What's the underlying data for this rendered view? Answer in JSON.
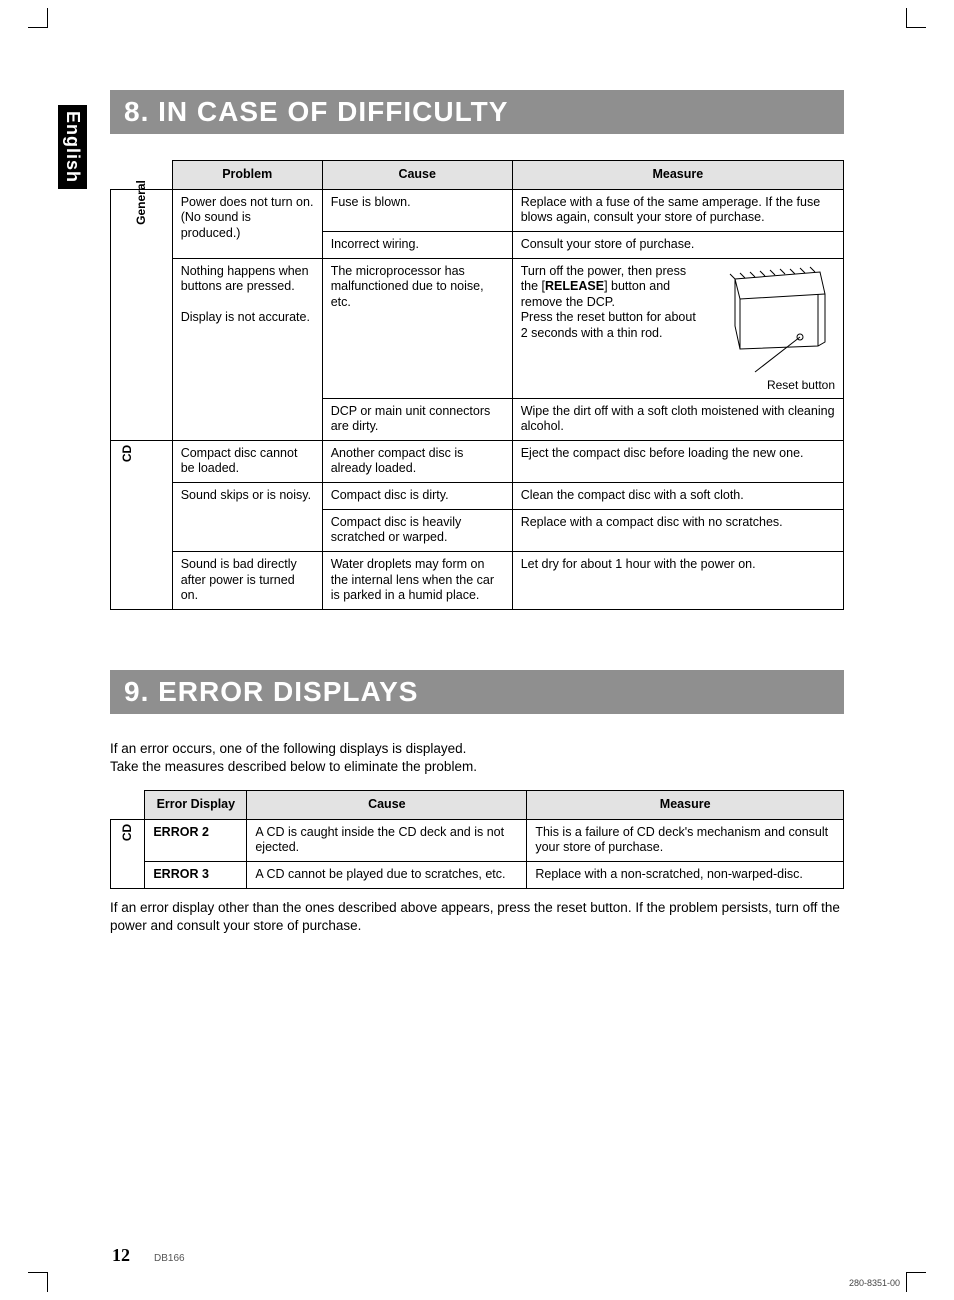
{
  "language_tab": "English",
  "section1": {
    "title": "8. IN CASE OF DIFFICULTY",
    "headers": [
      "Problem",
      "Cause",
      "Measure"
    ],
    "categories": [
      {
        "label": "General",
        "rows": [
          {
            "problem": "Power does not turn on.\n(No sound is produced.)",
            "entries": [
              {
                "cause": "Fuse is blown.",
                "measure": "Replace with a fuse of the same amperage. If the fuse blows again, consult your store of purchase."
              },
              {
                "cause": "Incorrect wiring.",
                "measure": "Consult your store of purchase."
              }
            ]
          },
          {
            "problem": "Nothing happens when buttons are pressed.\n\nDisplay is not accurate.",
            "entries": [
              {
                "cause": "The microprocessor has malfunctioned due to noise, etc.",
                "measure_pre": "Turn off the power, then press the [",
                "measure_bold": "RELEASE",
                "measure_post": "] button and remove the DCP.\nPress the reset button for about 2 seconds with a thin rod.",
                "reset_caption": "Reset button",
                "has_illustration": true
              },
              {
                "cause": "DCP or main unit connectors are dirty.",
                "measure": "Wipe the dirt off with a soft cloth moistened with cleaning alcohol."
              }
            ]
          }
        ]
      },
      {
        "label": "CD",
        "rows": [
          {
            "problem": "Compact disc cannot be loaded.",
            "entries": [
              {
                "cause": "Another compact disc is already loaded.",
                "measure": "Eject the compact disc before loading the new one."
              }
            ]
          },
          {
            "problem": "Sound skips or is noisy.",
            "entries": [
              {
                "cause": "Compact disc is dirty.",
                "measure": "Clean the compact disc with a soft cloth."
              },
              {
                "cause": "Compact disc is heavily scratched or warped.",
                "measure": "Replace with a compact disc with no scratches."
              }
            ]
          },
          {
            "problem": "Sound is bad directly after power is turned on.",
            "entries": [
              {
                "cause": "Water droplets may form on the internal lens when the car is parked in a humid place.",
                "measure": "Let dry for about 1 hour with the power on."
              }
            ]
          }
        ]
      }
    ]
  },
  "section2": {
    "title": "9. ERROR DISPLAYS",
    "intro": "If an error occurs, one of the following displays is displayed.\nTake the measures described below to eliminate the problem.",
    "headers": [
      "Error Display",
      "Cause",
      "Measure"
    ],
    "category_label": "CD",
    "rows": [
      {
        "display": "ERROR 2",
        "cause": "A CD is caught inside the CD deck and is not ejected.",
        "measure": "This is a failure of CD deck's mechanism and consult your store of purchase."
      },
      {
        "display": "ERROR 3",
        "cause": "A CD cannot be played due to scratches, etc.",
        "measure": "Replace with a non-scratched, non-warped-disc."
      }
    ],
    "outro": "If an error display other than the ones described above appears, press the reset button. If the problem persists, turn off the power and consult your store of purchase."
  },
  "footer": {
    "page_number": "12",
    "model": "DB166",
    "doc_number": "280-8351-00"
  }
}
